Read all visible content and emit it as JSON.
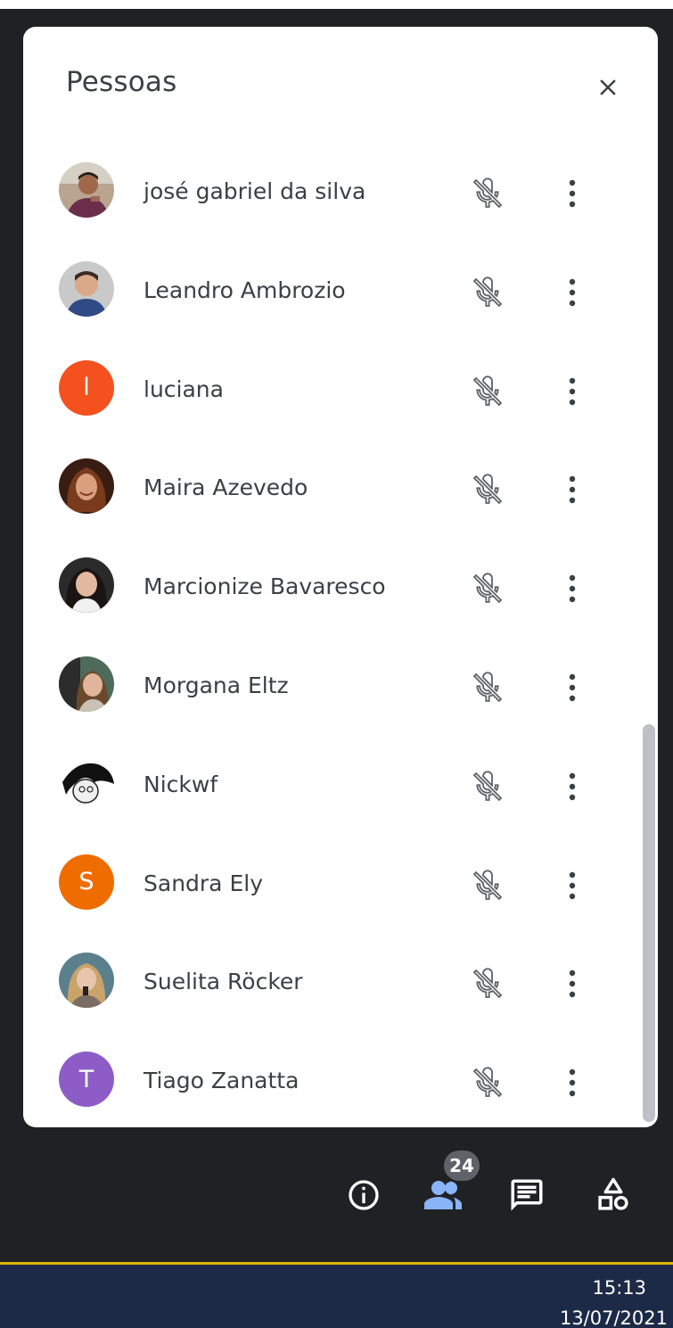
{
  "panel": {
    "title": "Pessoas",
    "close_icon": "close-icon"
  },
  "participants": [
    {
      "name": "josé gabriel da silva",
      "avatar_type": "photo",
      "mic_icon": "mic-off-icon",
      "more_icon": "more-vert-icon"
    },
    {
      "name": "Leandro Ambrozio",
      "avatar_type": "photo",
      "mic_icon": "mic-off-icon",
      "more_icon": "more-vert-icon"
    },
    {
      "name": "luciana",
      "avatar_type": "initial",
      "initial": "l",
      "avatar_color": "#f4511e",
      "mic_icon": "mic-off-icon",
      "more_icon": "more-vert-icon"
    },
    {
      "name": "Maira Azevedo",
      "avatar_type": "photo",
      "mic_icon": "mic-off-icon",
      "more_icon": "more-vert-icon"
    },
    {
      "name": "Marcionize Bavaresco",
      "avatar_type": "photo",
      "mic_icon": "mic-off-icon",
      "more_icon": "more-vert-icon"
    },
    {
      "name": "Morgana Eltz",
      "avatar_type": "photo",
      "mic_icon": "mic-off-icon",
      "more_icon": "more-vert-icon"
    },
    {
      "name": "Nickwf",
      "avatar_type": "photo",
      "mic_icon": "mic-off-icon",
      "more_icon": "more-vert-icon"
    },
    {
      "name": "Sandra Ely",
      "avatar_type": "initial",
      "initial": "S",
      "avatar_color": "#ef6c00",
      "mic_icon": "mic-off-icon",
      "more_icon": "more-vert-icon"
    },
    {
      "name": "Suelita Röcker",
      "avatar_type": "photo",
      "mic_icon": "mic-off-icon",
      "more_icon": "more-vert-icon"
    },
    {
      "name": "Tiago Zanatta",
      "avatar_type": "initial",
      "initial": "T",
      "avatar_color": "#8e5cc7",
      "mic_icon": "mic-off-icon",
      "more_icon": "more-vert-icon"
    }
  ],
  "toolbar": {
    "items": [
      {
        "icon": "info-icon",
        "active": false
      },
      {
        "icon": "people-icon",
        "active": true,
        "badge": "24"
      },
      {
        "icon": "chat-icon",
        "active": false
      },
      {
        "icon": "activities-icon",
        "active": false
      }
    ],
    "active_color": "#8ab4f8"
  },
  "taskbar": {
    "time": "15:13",
    "date": "13/07/2021"
  }
}
